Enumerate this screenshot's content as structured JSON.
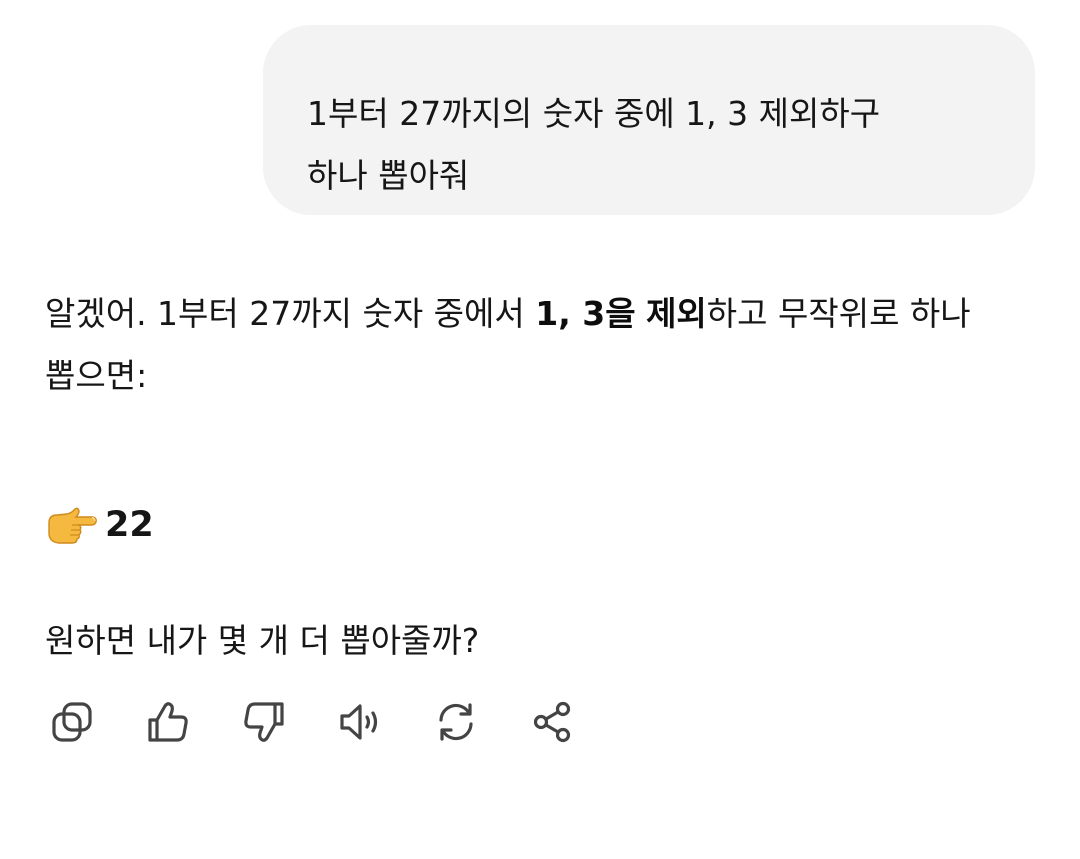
{
  "user_message": {
    "lines": [
      "1부터 27까지의 숫자 중에 1, 3 제외하구",
      "하나 뽑아줘"
    ]
  },
  "assistant_message": {
    "line1_prefix": "알겠어. 1부터 27까지 숫자 중에서 ",
    "line1_bold_1": "1, 3을",
    "line1_space": " ",
    "line1_bold_2": "제외",
    "line1_suffix": "하고 무작위로 하나",
    "line2": "뽑으면:",
    "pick_emoji": "pointing-right-hand-emoji",
    "pick_value": "22",
    "followup": "원하면 내가 몇 개 더 뽑아줄까?"
  },
  "actions": [
    {
      "name": "copy",
      "icon": "copy-icon"
    },
    {
      "name": "like",
      "icon": "thumbs-up-icon"
    },
    {
      "name": "dislike",
      "icon": "thumbs-down-icon"
    },
    {
      "name": "read-aloud",
      "icon": "speaker-icon"
    },
    {
      "name": "regenerate",
      "icon": "refresh-icon"
    },
    {
      "name": "share",
      "icon": "share-icon"
    }
  ],
  "colors": {
    "bubble_bg": "#f3f3f3",
    "text": "#161616",
    "icon": "#444444"
  }
}
